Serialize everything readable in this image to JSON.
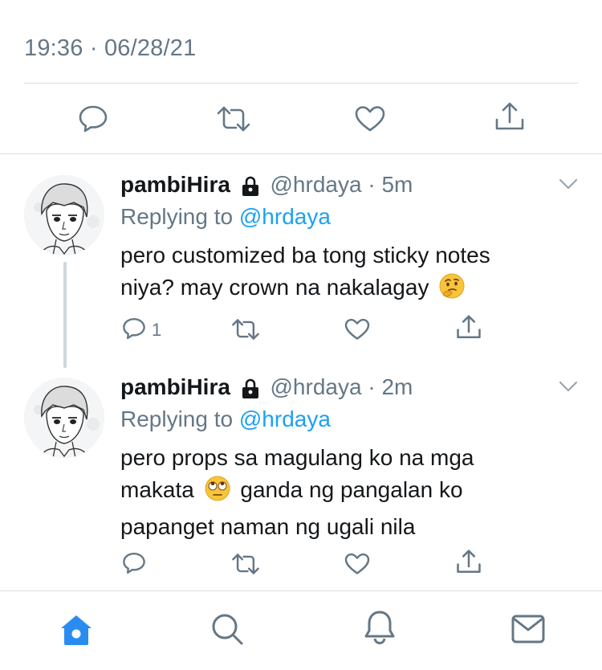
{
  "tweet_header": {
    "timestamp": "19:36 · 06/28/21"
  },
  "colors": {
    "accent": "#1da1f2",
    "muted": "#657786",
    "home_active": "#2a8cf0"
  },
  "replies": [
    {
      "display_name": "pambiHira",
      "handle": "@hrdaya",
      "separator": "·",
      "time": "5m",
      "replying_prefix": "Replying to",
      "replying_handle": "@hrdaya",
      "line1": "pero customized ba tong sticky notes",
      "line2": "niya? may crown na nakalagay",
      "emoji": "thinking-face",
      "reply_count": "1"
    },
    {
      "display_name": "pambiHira",
      "handle": "@hrdaya",
      "separator": "·",
      "time": "2m",
      "replying_prefix": "Replying to",
      "replying_handle": "@hrdaya",
      "line1": "pero props sa magulang ko na mga",
      "line2a": "makata",
      "line2b": "ganda ng pangalan ko",
      "line3": "papanget naman ng ugali nila",
      "emoji": "rolling-eyes-face",
      "reply_count": ""
    }
  ],
  "tab_bar": [
    "home-icon",
    "search-icon",
    "notifications-icon",
    "messages-icon"
  ]
}
